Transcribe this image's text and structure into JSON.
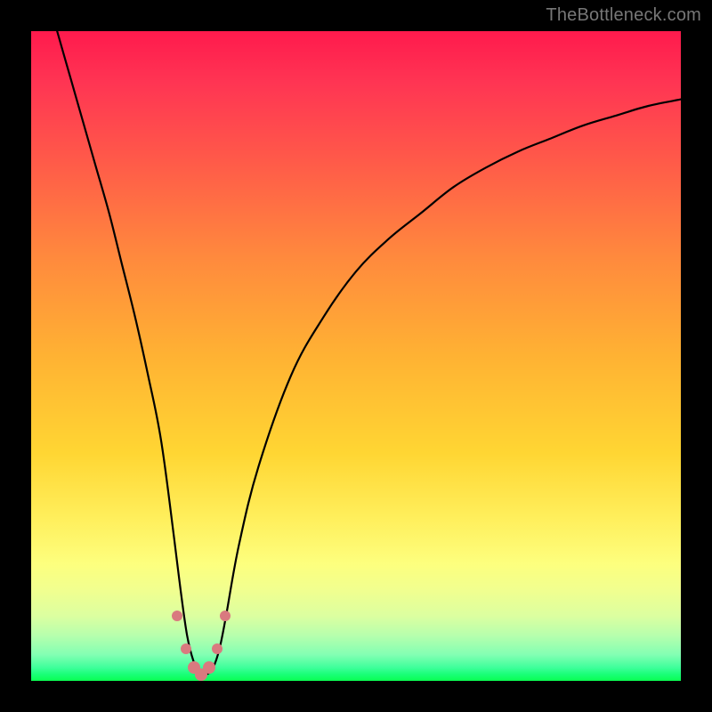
{
  "watermark": "TheBottleneck.com",
  "chart_data": {
    "type": "line",
    "title": "",
    "xlabel": "",
    "ylabel": "",
    "xlim": [
      0,
      100
    ],
    "ylim": [
      0,
      100
    ],
    "background_gradient": {
      "top": "#ff1a4d",
      "bottom": "#0aff52",
      "meaning": "red (high bottleneck) to green (low bottleneck)"
    },
    "series": [
      {
        "name": "bottleneck-curve",
        "x": [
          4,
          6,
          8,
          10,
          12,
          14,
          16,
          18,
          20,
          22,
          23,
          24,
          25,
          26,
          27,
          28,
          29,
          30,
          32,
          35,
          40,
          45,
          50,
          55,
          60,
          65,
          70,
          75,
          80,
          85,
          90,
          95,
          100
        ],
        "values": [
          100,
          93,
          86,
          79,
          72,
          64,
          56,
          47,
          37,
          22,
          14,
          7,
          3,
          1,
          1,
          2,
          5,
          10,
          21,
          33,
          47,
          56,
          63,
          68,
          72,
          76,
          79,
          81.5,
          83.5,
          85.5,
          87,
          88.5,
          89.5
        ]
      }
    ],
    "markers": {
      "color": "#d97a7f",
      "points": [
        {
          "x": 22.5,
          "y": 10,
          "size": 12
        },
        {
          "x": 23.8,
          "y": 5,
          "size": 12
        },
        {
          "x": 25.0,
          "y": 2,
          "size": 14
        },
        {
          "x": 26.2,
          "y": 1,
          "size": 14
        },
        {
          "x": 27.4,
          "y": 2,
          "size": 14
        },
        {
          "x": 28.6,
          "y": 5,
          "size": 12
        },
        {
          "x": 29.8,
          "y": 10,
          "size": 12
        }
      ]
    },
    "minimum_at_x": 26
  }
}
